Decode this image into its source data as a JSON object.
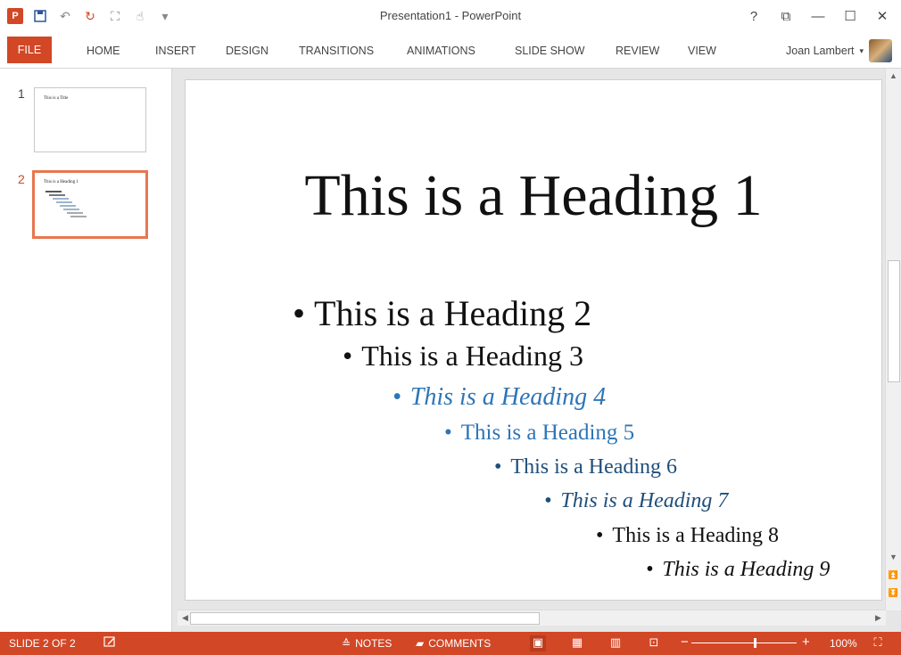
{
  "window": {
    "title": "Presentation1 - PowerPoint",
    "logo": "P",
    "controls": [
      "?",
      "⧉",
      "—",
      "☐",
      "✕"
    ]
  },
  "ribbon": {
    "tabs": [
      "FILE",
      "HOME",
      "INSERT",
      "DESIGN",
      "TRANSITIONS",
      "ANIMATIONS",
      "SLIDE SHOW",
      "REVIEW",
      "VIEW"
    ],
    "user": "Joan Lambert"
  },
  "thumbnails": [
    {
      "number": "1",
      "title": "This is a Title"
    },
    {
      "number": "2",
      "title": "This is a Heading 1",
      "active": true
    }
  ],
  "slide": {
    "title": "This is a Heading 1",
    "bullets": [
      "This is a Heading 2",
      "This is a Heading 3",
      "This is a Heading 4",
      "This is a Heading 5",
      "This is a Heading 6",
      "This is a Heading 7",
      "This is a Heading 8",
      "This is a Heading 9"
    ]
  },
  "statusbar": {
    "slide_info": "SLIDE 2 OF 2",
    "notes": "NOTES",
    "comments": "COMMENTS",
    "zoom": "100%",
    "zoom_level": 0.6
  },
  "colors": {
    "accent": "#d24726",
    "heading_blue": "#2e75b6",
    "heading_dark_blue": "#1f4e79"
  }
}
